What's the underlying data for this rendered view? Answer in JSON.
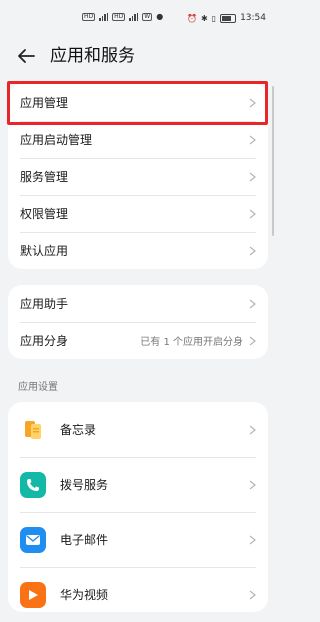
{
  "status_bar": {
    "time": "13:54",
    "battery_color": "#444444"
  },
  "header": {
    "title": "应用和服务"
  },
  "group1": [
    {
      "label": "应用管理"
    },
    {
      "label": "应用启动管理"
    },
    {
      "label": "服务管理"
    },
    {
      "label": "权限管理"
    },
    {
      "label": "默认应用"
    }
  ],
  "group2": [
    {
      "label": "应用助手",
      "value": ""
    },
    {
      "label": "应用分身",
      "value": "已有 1 个应用开启分身"
    }
  ],
  "section_title": "应用设置",
  "apps": [
    {
      "label": "备忘录",
      "icon": "memo-icon",
      "color": "#f6a623"
    },
    {
      "label": "拨号服务",
      "icon": "phone-icon",
      "color": "#14b8a6"
    },
    {
      "label": "电子邮件",
      "icon": "email-icon",
      "color": "#1f8ef1"
    },
    {
      "label": "华为视频",
      "icon": "video-icon",
      "color": "#f97316"
    }
  ],
  "highlight_color": "#e8262a"
}
